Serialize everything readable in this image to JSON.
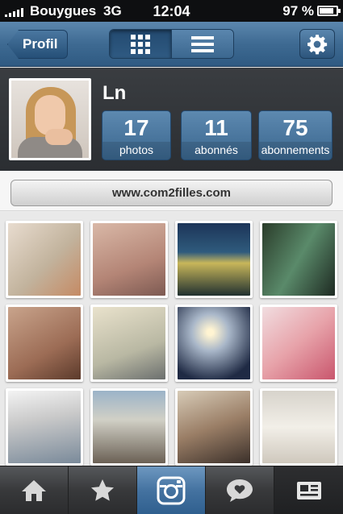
{
  "status_bar": {
    "carrier": "Bouygues",
    "network": "3G",
    "time": "12:04",
    "battery": "97 %"
  },
  "nav": {
    "back_label": "Profil",
    "view_modes": [
      "grid-icon",
      "list-icon"
    ],
    "active_view": "grid-icon",
    "settings_icon": "gear-icon"
  },
  "profile": {
    "username": "Ln",
    "stats": [
      {
        "value": "17",
        "label": "photos"
      },
      {
        "value": "11",
        "label": "abonnés"
      },
      {
        "value": "75",
        "label": "abonnements"
      }
    ],
    "website": "www.com2filles.com"
  },
  "tabs": [
    "home-icon",
    "star-icon",
    "camera-icon",
    "comment-heart-icon",
    "news-icon"
  ],
  "colors": {
    "nav_blue": "#3e6a92",
    "stat_blue": "#4b78a0",
    "camera_tab_blue": "#4472a0"
  }
}
